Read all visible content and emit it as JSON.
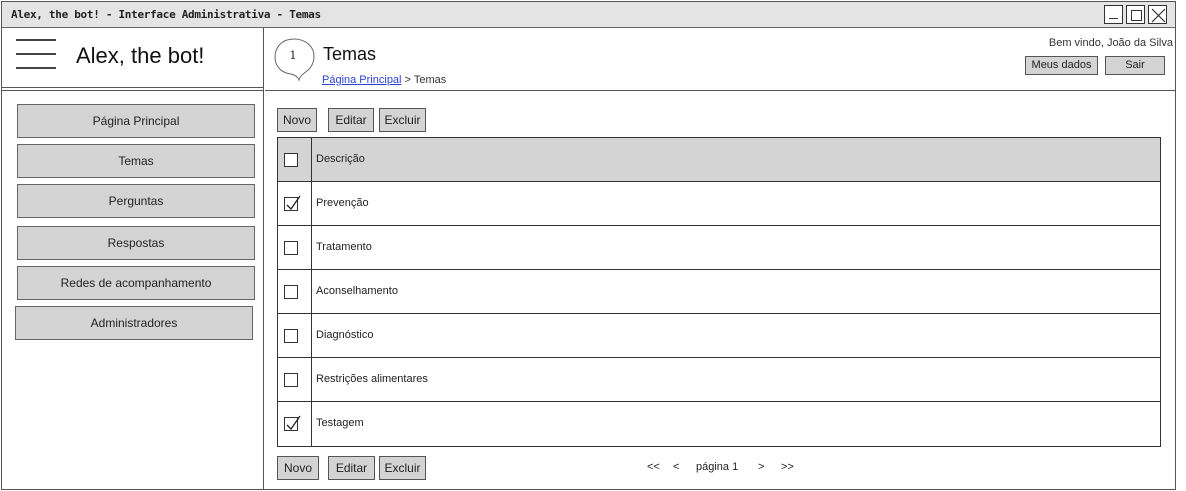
{
  "window": {
    "title": "Alex, the bot! - Interface Administrativa - Temas"
  },
  "sidebar": {
    "brand": "Alex, the bot!",
    "items": [
      {
        "label": "Página Principal"
      },
      {
        "label": "Temas"
      },
      {
        "label": "Perguntas"
      },
      {
        "label": "Respostas"
      },
      {
        "label": "Redes de acompanhamento"
      },
      {
        "label": "Administradores"
      }
    ]
  },
  "header": {
    "step": "1",
    "title": "Temas",
    "breadcrumb": {
      "home": "Página Principal",
      "separator": " > ",
      "current": "Temas"
    },
    "welcome": "Bem vindo, João da Silva",
    "my_data_label": "Meus dados",
    "logout_label": "Sair"
  },
  "actions": {
    "new_label": "Novo",
    "edit_label": "Editar",
    "delete_label": "Excluir"
  },
  "table": {
    "header": "Descrição",
    "rows": [
      {
        "label": "Prevenção",
        "checked": true
      },
      {
        "label": "Tratamento",
        "checked": false
      },
      {
        "label": "Aconselhamento",
        "checked": false
      },
      {
        "label": "Diagnóstico",
        "checked": false
      },
      {
        "label": "Restrições alimentares",
        "checked": false
      },
      {
        "label": "Testagem",
        "checked": true
      }
    ]
  },
  "pagination": {
    "first": "<<",
    "prev": "<",
    "page_label": "página 1",
    "next": ">",
    "last": ">>"
  }
}
